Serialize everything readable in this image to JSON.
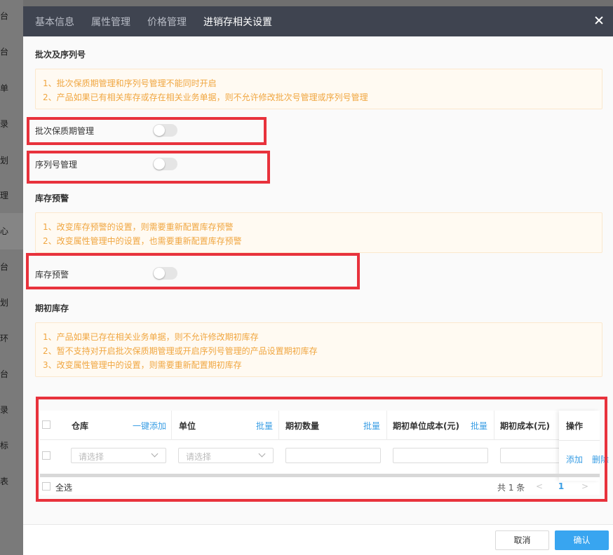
{
  "background": {
    "glyphs": [
      "台",
      "台",
      "单",
      "录",
      "划",
      "理",
      "心",
      "台",
      "划",
      "环",
      "台",
      "录",
      "标",
      "表"
    ]
  },
  "tabs": [
    {
      "label": "基本信息",
      "active": false
    },
    {
      "label": "属性管理",
      "active": false
    },
    {
      "label": "价格管理",
      "active": false
    },
    {
      "label": "进销存相关设置",
      "active": true
    }
  ],
  "sections": {
    "batch": {
      "title": "批次及序列号",
      "notes": [
        "1、批次保质期管理和序列号管理不能同时开启",
        "2、产品如果已有相关库存或存在相关业务单据，则不允许修改批次号管理或序列号管理"
      ],
      "batch_label": "批次保质期管理",
      "batch_on": false,
      "serial_label": "序列号管理",
      "serial_on": false
    },
    "warning": {
      "title": "库存预警",
      "notes": [
        "1、改变库存预警的设置，则需要重新配置库存预警",
        "2、改变属性管理中的设置，也需要重新配置库存预警"
      ],
      "label": "库存预警",
      "on": false
    },
    "initial": {
      "title": "期初库存",
      "notes": [
        "1、产品如果已存在相关业务单据，则不允许修改期初库存",
        "2、暂不支持对开启批次保质期管理或开启序列号管理的产品设置期初库存",
        "3、改变属性管理中的设置，则需要重新配置期初库存"
      ]
    }
  },
  "table": {
    "columns": [
      {
        "label": "仓库",
        "action": "一键添加"
      },
      {
        "label": "单位",
        "action": "批量"
      },
      {
        "label": "期初数量",
        "action": "批量"
      },
      {
        "label": "期初单位成本(元)",
        "action": "批量"
      },
      {
        "label": "期初成本(元)",
        "action": ""
      }
    ],
    "ops_header": "操作",
    "row": {
      "warehouse_placeholder": "请选择",
      "unit_placeholder": "请选择",
      "add": "添加",
      "delete": "删除"
    },
    "select_all": "全选",
    "total": "共 1 条",
    "page": "1",
    "prev": "<",
    "next": ">"
  },
  "footer": {
    "cancel": "取消",
    "ok": "确认"
  },
  "colors": {
    "accent": "#38a5f0",
    "highlight": "#e8323c",
    "notice_text": "#f0a640"
  }
}
